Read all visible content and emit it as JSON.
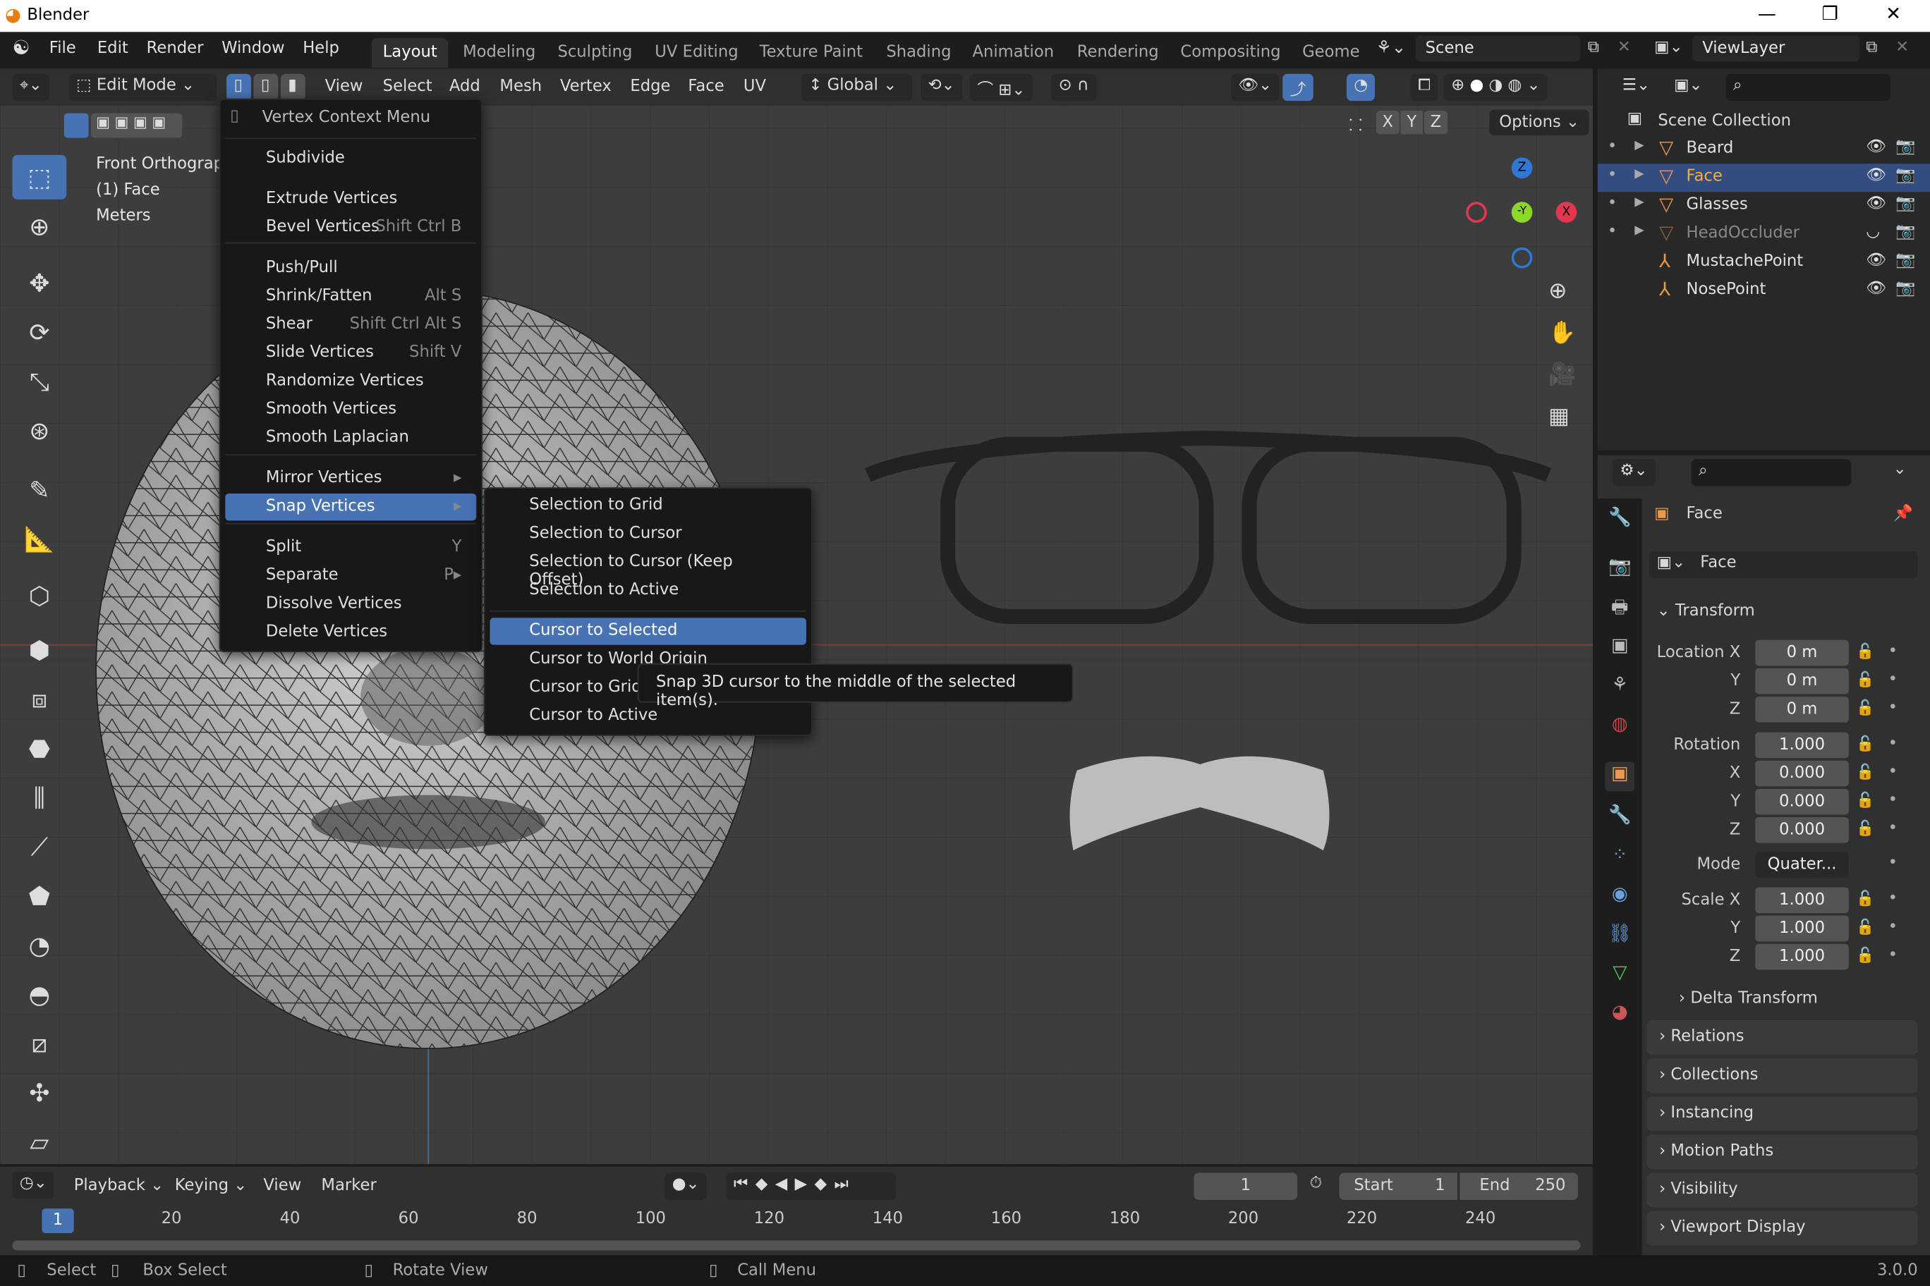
{
  "title": "Blender",
  "window_controls": {
    "minimize": "—",
    "maximize": "❐",
    "close": "✕"
  },
  "menubar": {
    "items": [
      "File",
      "Edit",
      "Render",
      "Window",
      "Help"
    ],
    "workspaces": [
      "Layout",
      "Modeling",
      "Sculpting",
      "UV Editing",
      "Texture Paint",
      "Shading",
      "Animation",
      "Rendering",
      "Compositing",
      "Geome"
    ],
    "active_workspace": "Layout",
    "scene": "Scene",
    "view_layer": "ViewLayer"
  },
  "viewport_header": {
    "mode": "Edit Mode",
    "menus": [
      "View",
      "Select",
      "Add",
      "Mesh",
      "Vertex",
      "Edge",
      "Face",
      "UV"
    ],
    "orientation": "Global",
    "options": "Options",
    "axes": [
      "X",
      "Y",
      "Z"
    ]
  },
  "overlay": {
    "view": "Front Orthographic",
    "object": "(1) Face",
    "units": "Meters"
  },
  "gizmo": {
    "z": "Z",
    "y": "-Y",
    "x": "X"
  },
  "context_menu": {
    "title": "Vertex Context Menu",
    "items": [
      {
        "label": "Subdivide",
        "shortcut": ""
      },
      {
        "label": "Extrude Vertices",
        "shortcut": ""
      },
      {
        "label": "Bevel Vertices",
        "shortcut": "Shift Ctrl B"
      },
      {
        "label": "Push/Pull",
        "shortcut": ""
      },
      {
        "label": "Shrink/Fatten",
        "shortcut": "Alt S"
      },
      {
        "label": "Shear",
        "shortcut": "Shift Ctrl Alt S"
      },
      {
        "label": "Slide Vertices",
        "shortcut": "Shift V"
      },
      {
        "label": "Randomize Vertices",
        "shortcut": ""
      },
      {
        "label": "Smooth Vertices",
        "shortcut": ""
      },
      {
        "label": "Smooth Laplacian",
        "shortcut": ""
      },
      {
        "label": "Mirror Vertices",
        "shortcut": "▸"
      },
      {
        "label": "Snap Vertices",
        "shortcut": "▸"
      },
      {
        "label": "Split",
        "shortcut": "Y"
      },
      {
        "label": "Separate",
        "shortcut": "P▸"
      },
      {
        "label": "Dissolve Vertices",
        "shortcut": ""
      },
      {
        "label": "Delete Vertices",
        "shortcut": ""
      }
    ],
    "highlighted": "Snap Vertices"
  },
  "snap_submenu": {
    "items": [
      "Selection to Grid",
      "Selection to Cursor",
      "Selection to Cursor (Keep Offset)",
      "Selection to Active",
      "Cursor to Selected",
      "Cursor to World Origin",
      "Cursor to Grid",
      "Cursor to Active"
    ],
    "highlighted": "Cursor to Selected"
  },
  "tooltip": "Snap 3D cursor to the middle of the selected item(s).",
  "outliner": {
    "root": "Scene Collection",
    "items": [
      {
        "name": "Beard",
        "type": "mesh",
        "selected": false
      },
      {
        "name": "Face",
        "type": "mesh",
        "selected": true
      },
      {
        "name": "Glasses",
        "type": "mesh",
        "selected": false
      },
      {
        "name": "HeadOccluder",
        "type": "mesh",
        "selected": false,
        "hidden": true
      },
      {
        "name": "MustachePoint",
        "type": "empty",
        "selected": false
      },
      {
        "name": "NosePoint",
        "type": "empty",
        "selected": false
      }
    ]
  },
  "properties": {
    "object_name": "Face",
    "data_name": "Face",
    "transform_label": "Transform",
    "location": {
      "label": "Location X",
      "x": "0 m",
      "y": "0 m",
      "z": "0 m"
    },
    "rotation": {
      "label": "Rotation",
      "w": "1.000",
      "x": "0.000",
      "y": "0.000",
      "z": "0.000"
    },
    "mode_label": "Mode",
    "mode": "Quater...",
    "scale": {
      "label": "Scale X",
      "x": "1.000",
      "y": "1.000",
      "z": "1.000"
    },
    "axis_labels": [
      "Y",
      "Z",
      "X",
      "W"
    ],
    "delta": "Delta Transform",
    "panels": [
      "Relations",
      "Collections",
      "Instancing",
      "Motion Paths",
      "Visibility",
      "Viewport Display"
    ]
  },
  "timeline": {
    "menus": [
      "Playback",
      "Keying",
      "View",
      "Marker"
    ],
    "current_frame": "1",
    "start_label": "Start",
    "start": "1",
    "end_label": "End",
    "end": "250",
    "ticks": [
      "20",
      "40",
      "60",
      "80",
      "100",
      "120",
      "140",
      "160",
      "180",
      "200",
      "220",
      "240"
    ]
  },
  "statusbar": {
    "items": [
      "Select",
      "Box Select",
      "Rotate View",
      "Call Menu"
    ],
    "version": "3.0.0"
  },
  "colors": {
    "accent": "#4772b3",
    "object_orange": "#e99a4a",
    "background": "#3d3d3d"
  }
}
